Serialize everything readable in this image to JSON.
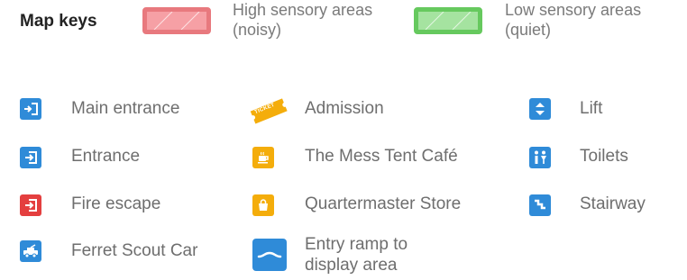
{
  "header": {
    "title": "Map keys",
    "high_line1": "High sensory areas",
    "high_line2": "(noisy)",
    "low_line1": "Low sensory areas",
    "low_line2": "(quiet)"
  },
  "colors": {
    "high_fill": "#f6a0a5",
    "high_border": "#e8797e",
    "low_fill": "#a5e3a0",
    "low_border": "#66c95e",
    "blue": "#2f8bd8",
    "red": "#e43f3f",
    "yellow": "#f4ad0b"
  },
  "keys": {
    "main_entrance": "Main entrance",
    "entrance": "Entrance",
    "fire_escape": "Fire escape",
    "ferret": "Ferret Scout Car",
    "admission": "Admission",
    "admission_ticket_text": "TICKET",
    "cafe": "The Mess Tent Café",
    "store": "Quartermaster Store",
    "ramp_line1": "Entry ramp to",
    "ramp_line2": "display area",
    "lift": "Lift",
    "toilets": "Toilets",
    "stairway": "Stairway"
  }
}
